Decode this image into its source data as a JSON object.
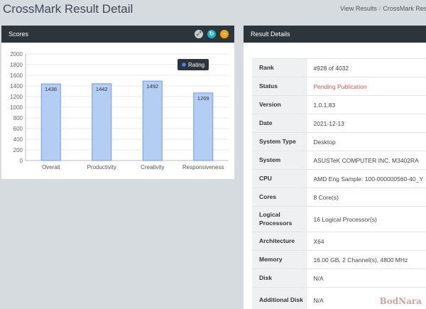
{
  "header": {
    "title": "CrossMark Result Detail",
    "breadcrumb": [
      "View Results",
      "CrossMark Resu"
    ]
  },
  "scores_panel": {
    "title": "Scores",
    "tools": [
      {
        "name": "expand-icon",
        "glyph": "⤢"
      },
      {
        "name": "reload-icon",
        "glyph": "↻"
      },
      {
        "name": "collapse-icon",
        "glyph": "−"
      }
    ]
  },
  "chart_data": {
    "type": "bar",
    "categories": [
      "Overall",
      "Productivity",
      "Creativity",
      "Responsiveness"
    ],
    "series": [
      {
        "name": "Rating",
        "values": [
          1438,
          1442,
          1492,
          1269
        ]
      }
    ],
    "yticks": [
      0,
      200,
      400,
      600,
      800,
      1000,
      1200,
      1400,
      1600,
      1800,
      2000
    ],
    "ylim": [
      0,
      2000
    ],
    "legend_position": "top-right",
    "grid": true,
    "colors": {
      "bar_fill": "#b3cdf3",
      "bar_stroke": "#6f9be0",
      "legend_dot": "#4a86e8"
    }
  },
  "details_panel": {
    "title": "Result Details",
    "rows": [
      {
        "key": "Rank",
        "value": "#928 of 4032"
      },
      {
        "key": "Status",
        "value": "Pending Publication",
        "status": "pending"
      },
      {
        "key": "Version",
        "value": "1.0.1.83"
      },
      {
        "key": "Date",
        "value": "2021-12-13"
      },
      {
        "key": "System Type",
        "value": "Desktop"
      },
      {
        "key": "System",
        "value": "ASUSTeK COMPUTER INC. M3402RA"
      },
      {
        "key": "CPU",
        "value": "AMD Eng Sample: 100-000000560-40_Y"
      },
      {
        "key": "Cores",
        "value": "8 Core(s)"
      },
      {
        "key": "Logical Processors",
        "value": "16 Logical Processor(s)"
      },
      {
        "key": "Architecture",
        "value": "X64"
      },
      {
        "key": "Memory",
        "value": "16.00 GB, 2 Channel(s), 4800 MHz"
      },
      {
        "key": "Disk",
        "value": "N/A"
      },
      {
        "key": "Additional Disk",
        "value": "N/A"
      }
    ]
  },
  "watermark": "BodNara",
  "colors": {
    "page_bg": "#d6dbe0",
    "panel_header_bg": "#2d353c",
    "pending_status": "#e05555"
  }
}
